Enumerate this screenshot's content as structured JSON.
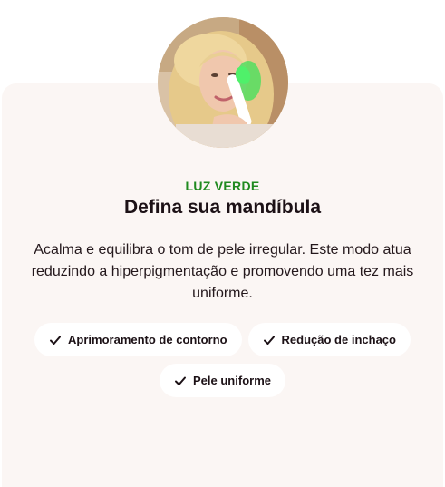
{
  "product": {
    "mode_label": "LUZ VERDE",
    "title": "Defina sua mandíbula",
    "description": "Acalma e equilibra o tom de pele irregular. Este modo atua reduzindo a hiperpigmentação e promovendo uma tez mais uniforme.",
    "benefits": [
      {
        "label": "Aprimoramento de contorno",
        "icon": "check-icon"
      },
      {
        "label": "Redução de inchaço",
        "icon": "check-icon"
      },
      {
        "label": "Pele uniforme",
        "icon": "check-icon"
      }
    ]
  },
  "colors": {
    "accent_green": "#1f8a1f",
    "card_background": "#fbf6f4",
    "text_dark": "#1c1116"
  }
}
